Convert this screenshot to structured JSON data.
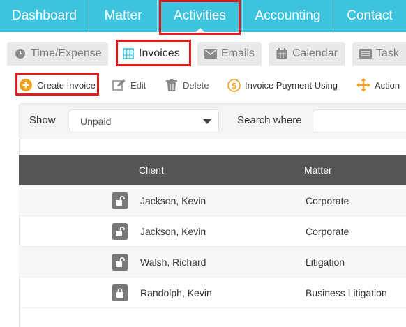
{
  "nav": {
    "items": [
      {
        "label": "Dashboard"
      },
      {
        "label": "Matter"
      },
      {
        "label": "Activities"
      },
      {
        "label": "Accounting"
      },
      {
        "label": "Contact"
      }
    ],
    "active": "Activities"
  },
  "subtabs": {
    "items": [
      {
        "label": "Time/Expense",
        "icon": "clock-icon"
      },
      {
        "label": "Invoices",
        "icon": "invoice-grid-icon"
      },
      {
        "label": "Emails",
        "icon": "envelope-icon"
      },
      {
        "label": "Calendar",
        "icon": "calendar-icon"
      },
      {
        "label": "Task",
        "icon": "task-list-icon"
      }
    ],
    "active": "Invoices"
  },
  "toolbar": {
    "create_invoice": "Create Invoice",
    "edit": "Edit",
    "delete": "Delete",
    "invoice_payment": "Invoice Payment Using",
    "action": "Action"
  },
  "filter": {
    "show_label": "Show",
    "show_value": "Unpaid",
    "search_label": "Search where"
  },
  "table": {
    "columns": {
      "client": "Client",
      "matter": "Matter"
    },
    "rows": [
      {
        "client": "Jackson, Kevin",
        "matter": "Corporate",
        "locked": false
      },
      {
        "client": "Jackson, Kevin",
        "matter": "Corporate",
        "locked": false
      },
      {
        "client": "Walsh, Richard",
        "matter": "Litigation",
        "locked": false
      },
      {
        "client": "Randolph, Kevin",
        "matter": "Business Litigation",
        "locked": true
      }
    ]
  },
  "colors": {
    "nav_bg": "#3ec3de",
    "header_bg": "#555555",
    "highlight": "#e01b1b",
    "create_icon": "#f0a020",
    "payment_icon": "#f0a020"
  }
}
